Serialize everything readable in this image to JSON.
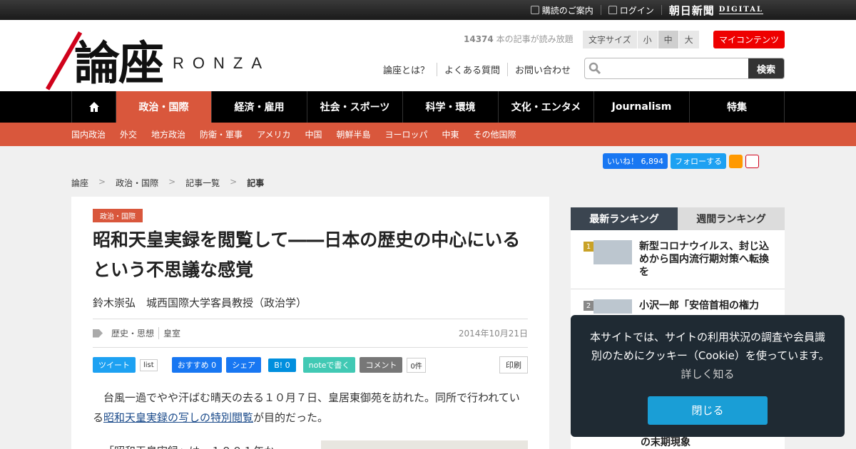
{
  "topbar": {
    "subscribe": "購読のご案内",
    "login": "ログイン",
    "brand": "朝日新聞",
    "brand_digital": "DIGITAL"
  },
  "header": {
    "logo_kanji": "論座",
    "logo_en": "RONZA",
    "count_num": "14374",
    "count_text": " 本の記事が読み放題",
    "fontsize_label": "文字サイズ",
    "fontsize_small": "小",
    "fontsize_medium": "中",
    "fontsize_large": "大",
    "mycontent": "マイコンテンツ",
    "links": [
      "論座とは？",
      "よくある質問",
      "お問い合わせ"
    ],
    "search_button": "検索"
  },
  "nav": {
    "items": [
      "政治・国際",
      "経済・雇用",
      "社会・スポーツ",
      "科学・環境",
      "文化・エンタメ",
      "Journalism",
      "特集"
    ]
  },
  "subnav": {
    "items": [
      "国内政治",
      "外交",
      "地方政治",
      "防衛・軍事",
      "アメリカ",
      "中国",
      "朝鮮半島",
      "ヨーロッパ",
      "中東",
      "その他国際"
    ]
  },
  "social": {
    "like": "いいね！ 6,894",
    "follow": "フォローする"
  },
  "breadcrumb": {
    "items": [
      "論座",
      "政治・国際",
      "記事一覧",
      "記事"
    ],
    "sep": ">"
  },
  "article": {
    "category": "政治・国際",
    "title": "昭和天皇実録を閲覧して――日本の歴史の中心にいるという不思議な感覚",
    "author": "鈴木崇弘　城西国際大学客員教授（政治学）",
    "tags": [
      "歴史・思想",
      "皇室"
    ],
    "date": "2014年10月21日",
    "share": {
      "tweet": "ツイート",
      "list": "list",
      "fb": "おすすめ 0",
      "fb_share": "シェア",
      "hatena": "B! 0",
      "note": "noteで書く",
      "comment": "コメント",
      "comment_count": "0件",
      "print": "印刷"
    },
    "para1_a": "台風一過でやや汗ばむ晴天の去る１０月７日、皇居東御苑を訪れた。同所で行われている",
    "para1_link": "昭和天皇実録の写しの特別閲覧",
    "para1_b": "が目的だった。",
    "para2": "「昭和天皇実録」は、１９０１年か"
  },
  "ranking": {
    "tab_latest": "最新ランキング",
    "tab_weekly": "週間ランキング",
    "items": [
      {
        "num": "1",
        "title": "新型コロナウイルス、封じ込めから国内流行期対策へ転換を"
      },
      {
        "num": "2",
        "title": "小沢一郎「安倍首相の権力"
      }
    ],
    "tail": "の末期現象"
  },
  "cookie": {
    "text": "本サイトでは、サイトの利用状況の調査や会員識別のためにクッキー（Cookie）を使っています。",
    "link": "詳しく知る",
    "button": "閉じる"
  }
}
